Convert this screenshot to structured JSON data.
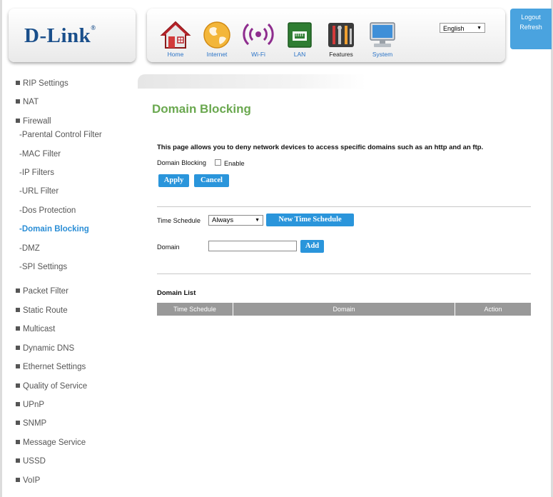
{
  "header": {
    "logo_text": "D-Link",
    "logo_reg": "®",
    "nav": [
      {
        "label": "Home",
        "icon": "home-icon"
      },
      {
        "label": "Internet",
        "icon": "globe-icon"
      },
      {
        "label": "Wi-Fi",
        "icon": "wifi-icon"
      },
      {
        "label": "LAN",
        "icon": "lan-icon"
      },
      {
        "label": "Features",
        "icon": "features-icon"
      },
      {
        "label": "System",
        "icon": "computer-icon"
      }
    ],
    "language": "English",
    "logout": "Logout",
    "refresh": "Refresh"
  },
  "sidebar": {
    "items": [
      {
        "label": "RIP Settings"
      },
      {
        "label": "NAT"
      },
      {
        "label": "Firewall"
      },
      {
        "label": "-Parental Control Filter"
      },
      {
        "label": "-MAC Filter"
      },
      {
        "label": "-IP Filters"
      },
      {
        "label": "-URL Filter"
      },
      {
        "label": "-Dos Protection"
      },
      {
        "label": "-Domain Blocking"
      },
      {
        "label": "-DMZ"
      },
      {
        "label": "-SPI Settings"
      },
      {
        "label": "Packet Filter"
      },
      {
        "label": "Static Route"
      },
      {
        "label": "Multicast"
      },
      {
        "label": "Dynamic DNS"
      },
      {
        "label": "Ethernet Settings"
      },
      {
        "label": "Quality of Service"
      },
      {
        "label": "UPnP"
      },
      {
        "label": "SNMP"
      },
      {
        "label": "Message Service"
      },
      {
        "label": "USSD"
      },
      {
        "label": "VoIP"
      }
    ]
  },
  "main": {
    "title": "Domain Blocking",
    "description": "This page allows you to deny network devices to access specific domains such as an http and an ftp.",
    "enable_label": "Domain Blocking",
    "enable_text": "Enable",
    "apply_label": "Apply",
    "cancel_label": "Cancel",
    "time_schedule_label": "Time Schedule",
    "time_schedule_value": "Always",
    "new_schedule_label": "New Time Schedule",
    "domain_label": "Domain",
    "domain_value": "",
    "add_label": "Add",
    "list_title": "Domain List",
    "columns": [
      "Time Schedule",
      "Domain",
      "Action"
    ]
  },
  "colors": {
    "accent": "#2a95db",
    "title_green": "#6aa84f",
    "logo_blue": "#1a4f8b",
    "table_header": "#999999"
  }
}
